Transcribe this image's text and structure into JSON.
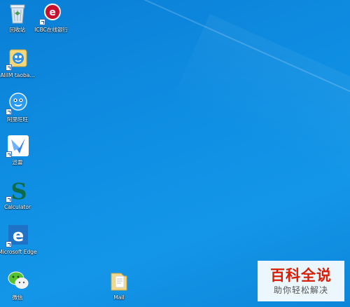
{
  "desktop": {
    "icons": [
      {
        "label": "回收站",
        "icon": "recycle-bin-icon"
      },
      {
        "label": "ICBC在线银行",
        "icon": "icbc-icon"
      },
      {
        "label": "AliIM taoba...",
        "icon": "aliim-icon"
      },
      {
        "label": "阿里旺旺",
        "icon": "aliwangwang-icon"
      },
      {
        "label": "迅雷",
        "icon": "xunlei-icon"
      },
      {
        "label": "Calculator",
        "icon": "calculator-icon"
      },
      {
        "label": "Microsoft Edge",
        "icon": "edge-icon"
      },
      {
        "label": "微信",
        "icon": "wechat-icon"
      },
      {
        "label": "Mail",
        "icon": "folder-icon"
      }
    ]
  },
  "watermark": {
    "title": "百科全说",
    "subtitle": "助你轻松解决",
    "title_color": "#d81e06"
  }
}
